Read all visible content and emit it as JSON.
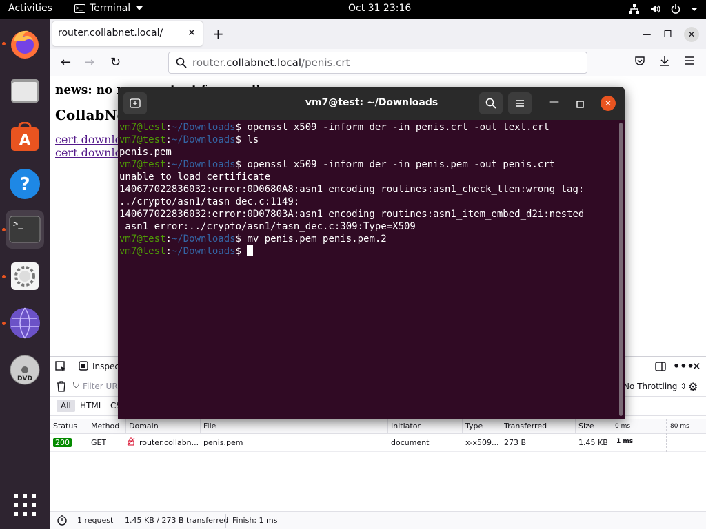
{
  "topbar": {
    "activities": "Activities",
    "app_name": "Terminal",
    "clock": "Oct 31  23:16"
  },
  "dock": {
    "items": [
      "firefox",
      "files",
      "software",
      "help",
      "terminal",
      "settings",
      "network",
      "dvd",
      "show-apps"
    ]
  },
  "browser": {
    "tab_title": "router.collabnet.local/",
    "url_prefix": "router.",
    "url_domain": "collabnet.local",
    "url_path": "/penis.crt",
    "page": {
      "heading1": "news: no new content for you lim...",
      "heading2": "CollabNe",
      "links": [
        "cert downlo",
        "cert downlo"
      ]
    }
  },
  "devtools": {
    "inspect_label": "Inspec",
    "filter_placeholder": "Filter UR",
    "throttling": "No Throttling ⇕",
    "types": [
      "All",
      "HTML",
      "CS"
    ],
    "columns": [
      "Status",
      "Method",
      "Domain",
      "File",
      "Initiator",
      "Type",
      "Transferred",
      "Size",
      "0 ms",
      "80 ms"
    ],
    "row": {
      "status": "200",
      "method": "GET",
      "domain": "router.collabn...",
      "file": "penis.pem",
      "initiator": "document",
      "type": "x-x509...",
      "transferred": "273 B",
      "size": "1.45 KB",
      "time": "1 ms"
    },
    "statusbar": {
      "requests": "1 request",
      "transferred": "1.45 KB / 273 B transferred",
      "finish": "Finish: 1 ms"
    }
  },
  "terminal": {
    "title": "vm7@test: ~/Downloads",
    "prompt_user": "vm7@test",
    "prompt_path": "~/Downloads",
    "lines": [
      {
        "type": "cmd",
        "text": "openssl x509 -inform der -in penis.crt -out text.crt"
      },
      {
        "type": "cmd",
        "text": "ls"
      },
      {
        "type": "out",
        "text": "penis.pem"
      },
      {
        "type": "cmd",
        "text": "openssl x509 -inform der -in penis.pem -out penis.crt"
      },
      {
        "type": "out",
        "text": "unable to load certificate"
      },
      {
        "type": "out",
        "text": "140677022836032:error:0D0680A8:asn1 encoding routines:asn1_check_tlen:wrong tag:"
      },
      {
        "type": "out",
        "text": "../crypto/asn1/tasn_dec.c:1149:"
      },
      {
        "type": "out",
        "text": "140677022836032:error:0D07803A:asn1 encoding routines:asn1_item_embed_d2i:nested"
      },
      {
        "type": "out",
        "text": " asn1 error:../crypto/asn1/tasn_dec.c:309:Type=X509"
      },
      {
        "type": "cmd",
        "text": "mv penis.pem penis.pem.2"
      },
      {
        "type": "cmd",
        "text": ""
      }
    ]
  },
  "colors": {
    "terminal_bg": "#300a24",
    "prompt_user": "#4e9a06",
    "prompt_path": "#3465a4",
    "dock_bg": "#2e2430",
    "accent": "#e95420"
  }
}
